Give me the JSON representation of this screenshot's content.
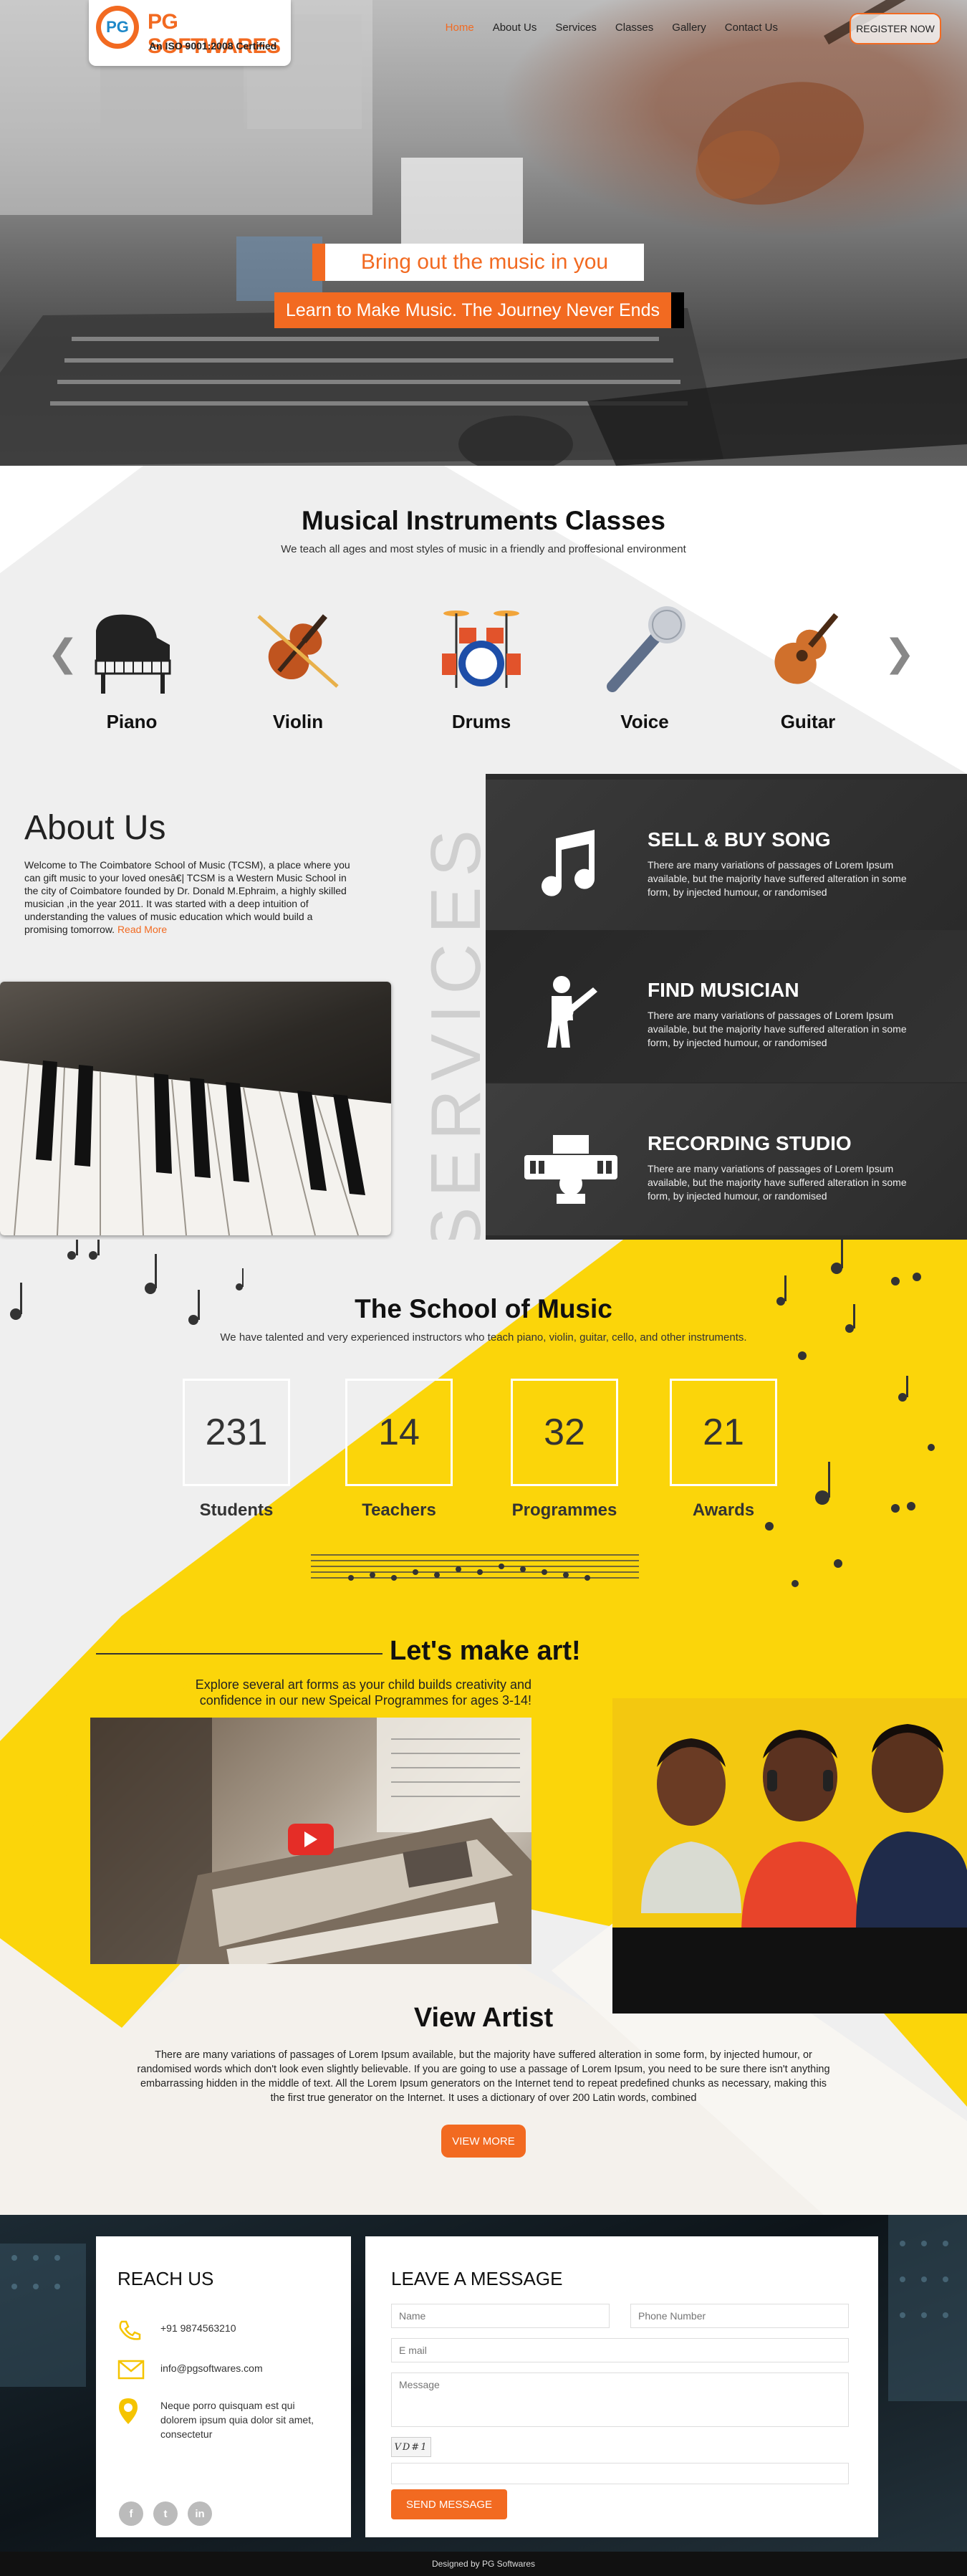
{
  "brand": {
    "name": "PG SOFTWARES",
    "certification": "An ISO 9001:2008 Certified",
    "accent": "#f26a21",
    "yellow": "#fbd50a"
  },
  "nav": {
    "items": [
      "Home",
      "About Us",
      "Services",
      "Classes",
      "Gallery",
      "Contact Us"
    ],
    "active": "Home",
    "register": "REGISTER NOW"
  },
  "hero": {
    "headline": "Bring out the music in you",
    "subline": "Learn to Make Music. The Journey Never Ends"
  },
  "classes": {
    "title": "Musical Instruments Classes",
    "subtitle": "We teach all ages and most styles of music in a friendly and proffesional environment",
    "prev_icon": "chevron-left-icon",
    "next_icon": "chevron-right-icon",
    "items": [
      {
        "label": "Piano",
        "icon": "piano-icon"
      },
      {
        "label": "Violin",
        "icon": "violin-icon"
      },
      {
        "label": "Drums",
        "icon": "drums-icon"
      },
      {
        "label": "Voice",
        "icon": "microphone-icon"
      },
      {
        "label": "Guitar",
        "icon": "guitar-icon"
      }
    ]
  },
  "about": {
    "title": "About Us",
    "text": "Welcome to The Coimbatore School of Music (TCSM), a place where you can gift music to your loved onesâ€| TCSM is a Western Music School in the city of Coimbatore founded by Dr. Donald M.Ephraim, a highly skilled musician ,in the year 2011. It was started with a deep intuition of understanding the values of music education which would build a promising tomorrow.",
    "read_more": "Read More"
  },
  "services": {
    "watermark": "SERVICES",
    "items": [
      {
        "title": "SELL & BUY SONG",
        "icon": "music-note-icon",
        "text": "There are many variations of passages of Lorem Ipsum available, but the majority have suffered alteration in some form, by injected humour, or randomised"
      },
      {
        "title": "FIND MUSICIAN",
        "icon": "guitarist-icon",
        "text": "There are many variations of passages of Lorem Ipsum available, but the majority have suffered alteration in some form, by injected humour, or randomised"
      },
      {
        "title": "RECORDING STUDIO",
        "icon": "studio-icon",
        "text": "There are many variations of passages of Lorem Ipsum available, but the majority have suffered alteration in some form, by injected humour, or randomised"
      }
    ]
  },
  "school": {
    "title": "The School of Music",
    "subtitle": "We have talented and very experienced instructors who teach piano, violin, guitar, cello, and other instruments.",
    "stats": [
      {
        "value": "231",
        "label": "Students"
      },
      {
        "value": "14",
        "label": "Teachers"
      },
      {
        "value": "32",
        "label": "Programmes"
      },
      {
        "value": "21",
        "label": "Awards"
      }
    ]
  },
  "art": {
    "title": "Let's make art!",
    "subtitle": "Explore several art forms as your child builds creativity and confidence in our new Speical Programmes for ages 3-14!",
    "video_icon": "play-icon"
  },
  "artist": {
    "title": "View Artist",
    "text": "There are many variations of passages of Lorem Ipsum available, but the majority have suffered alteration in some form, by injected humour, or randomised words which don't look even slightly believable. If you are going to use a passage of Lorem Ipsum, you need to be sure there isn't anything embarrassing hidden in the middle of text. All the Lorem Ipsum generators on the Internet tend to repeat predefined chunks as necessary, making this the first true generator on the Internet. It uses a dictionary of over 200 Latin words, combined",
    "button": "VIEW MORE"
  },
  "reach": {
    "title": "REACH US",
    "phone": "+91 9874563210",
    "email": "info@pgsoftwares.com",
    "address": "Neque porro quisquam est qui dolorem ipsum quia dolor sit amet, consectetur",
    "social": [
      "facebook-icon",
      "twitter-icon",
      "linkedin-icon"
    ]
  },
  "message": {
    "title": "LEAVE A MESSAGE",
    "name_placeholder": "Name",
    "phone_placeholder": "Phone Number",
    "email_placeholder": "E mail",
    "message_placeholder": "Message",
    "captcha": "VD#1",
    "send": "SEND MESSAGE"
  },
  "footer": {
    "credit": "Designed by PG Softwares"
  }
}
